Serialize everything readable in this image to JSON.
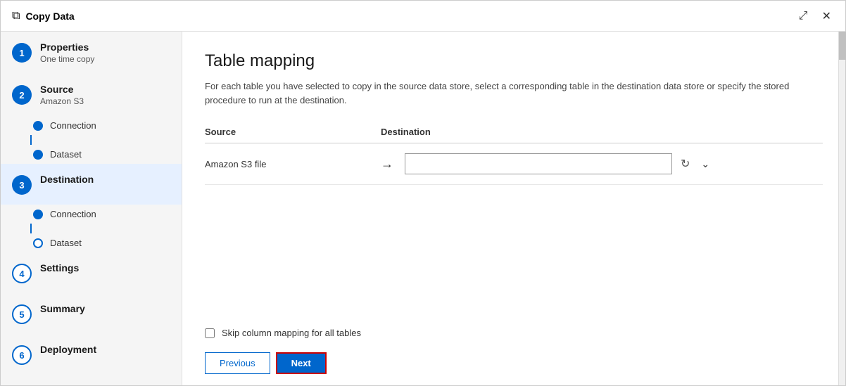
{
  "window": {
    "title": "Copy Data",
    "title_icon": "⧉",
    "expand_label": "⤢",
    "close_label": "✕"
  },
  "sidebar": {
    "steps": [
      {
        "number": "1",
        "label": "Properties",
        "sublabel": "One time copy",
        "active": false,
        "completed": true,
        "sub_items": []
      },
      {
        "number": "2",
        "label": "Source",
        "sublabel": "Amazon S3",
        "active": false,
        "completed": true,
        "sub_items": [
          {
            "label": "Connection",
            "filled": true
          },
          {
            "label": "Dataset",
            "filled": true
          }
        ]
      },
      {
        "number": "3",
        "label": "Destination",
        "sublabel": "",
        "active": true,
        "completed": false,
        "sub_items": [
          {
            "label": "Connection",
            "filled": true
          },
          {
            "label": "Dataset",
            "filled": false
          }
        ]
      },
      {
        "number": "4",
        "label": "Settings",
        "sublabel": "",
        "active": false,
        "completed": false,
        "sub_items": []
      },
      {
        "number": "5",
        "label": "Summary",
        "sublabel": "",
        "active": false,
        "completed": false,
        "sub_items": []
      },
      {
        "number": "6",
        "label": "Deployment",
        "sublabel": "",
        "active": false,
        "completed": false,
        "sub_items": []
      }
    ]
  },
  "panel": {
    "title": "Table mapping",
    "description": "For each table you have selected to copy in the source data store, select a corresponding table in the destination data store or specify the stored procedure to run at the destination.",
    "table_header": {
      "source_col": "Source",
      "dest_col": "Destination"
    },
    "table_rows": [
      {
        "source_name": "Amazon S3 file",
        "dest_value": ""
      }
    ],
    "dest_placeholder": "",
    "skip_label": "Skip column mapping for all tables",
    "prev_label": "Previous",
    "next_label": "Next"
  },
  "icons": {
    "arrow": "→",
    "refresh": "↻",
    "chevron_down": "⌄",
    "expand": "⤢",
    "close": "✕",
    "copy_data": "⧉"
  }
}
